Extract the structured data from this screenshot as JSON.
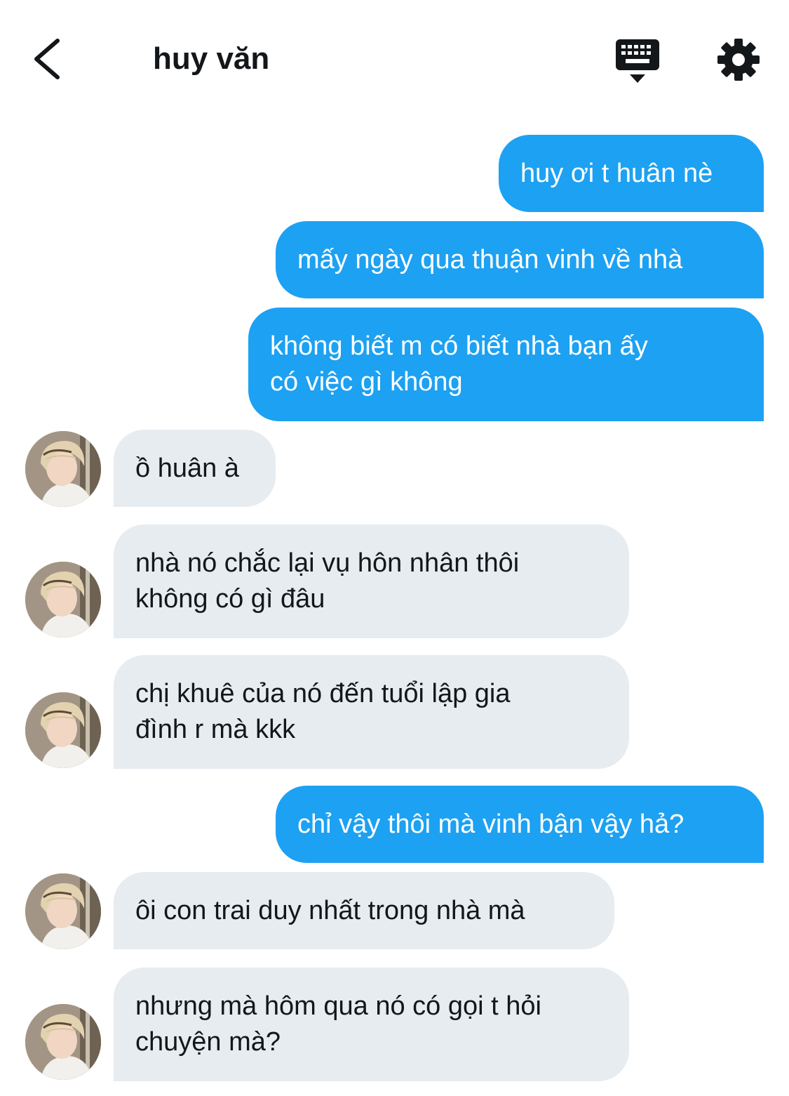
{
  "header": {
    "contact_name": "huy văn"
  },
  "icons": {
    "back": "chevron-left-icon",
    "keyboard": "keyboard-icon",
    "settings": "gear-icon"
  },
  "colors": {
    "outgoing_bubble": "#1da1f2",
    "incoming_bubble": "#e6ecf0",
    "text_dark": "#14171a"
  },
  "messages": [
    {
      "direction": "outgoing",
      "text": "huy ơi t huân nè"
    },
    {
      "direction": "outgoing",
      "text": "mấy ngày qua thuận vinh về nhà"
    },
    {
      "direction": "outgoing",
      "line1": "không biết m có biết nhà bạn ấy",
      "line2": "có việc gì không"
    },
    {
      "direction": "incoming",
      "text": "ồ huân à"
    },
    {
      "direction": "incoming",
      "line1": "nhà nó chắc lại vụ hôn nhân thôi",
      "line2": "không có gì đâu"
    },
    {
      "direction": "incoming",
      "line1": "chị khuê của nó đến tuổi lập gia",
      "line2": "đình r mà kkk"
    },
    {
      "direction": "outgoing",
      "text": "chỉ vậy thôi mà vinh bận vậy hả?"
    },
    {
      "direction": "incoming",
      "text": "ôi con trai duy nhất trong nhà mà"
    },
    {
      "direction": "incoming",
      "line1": "nhưng mà hôm qua nó có gọi t hỏi",
      "line2": "chuyện mà?"
    }
  ]
}
